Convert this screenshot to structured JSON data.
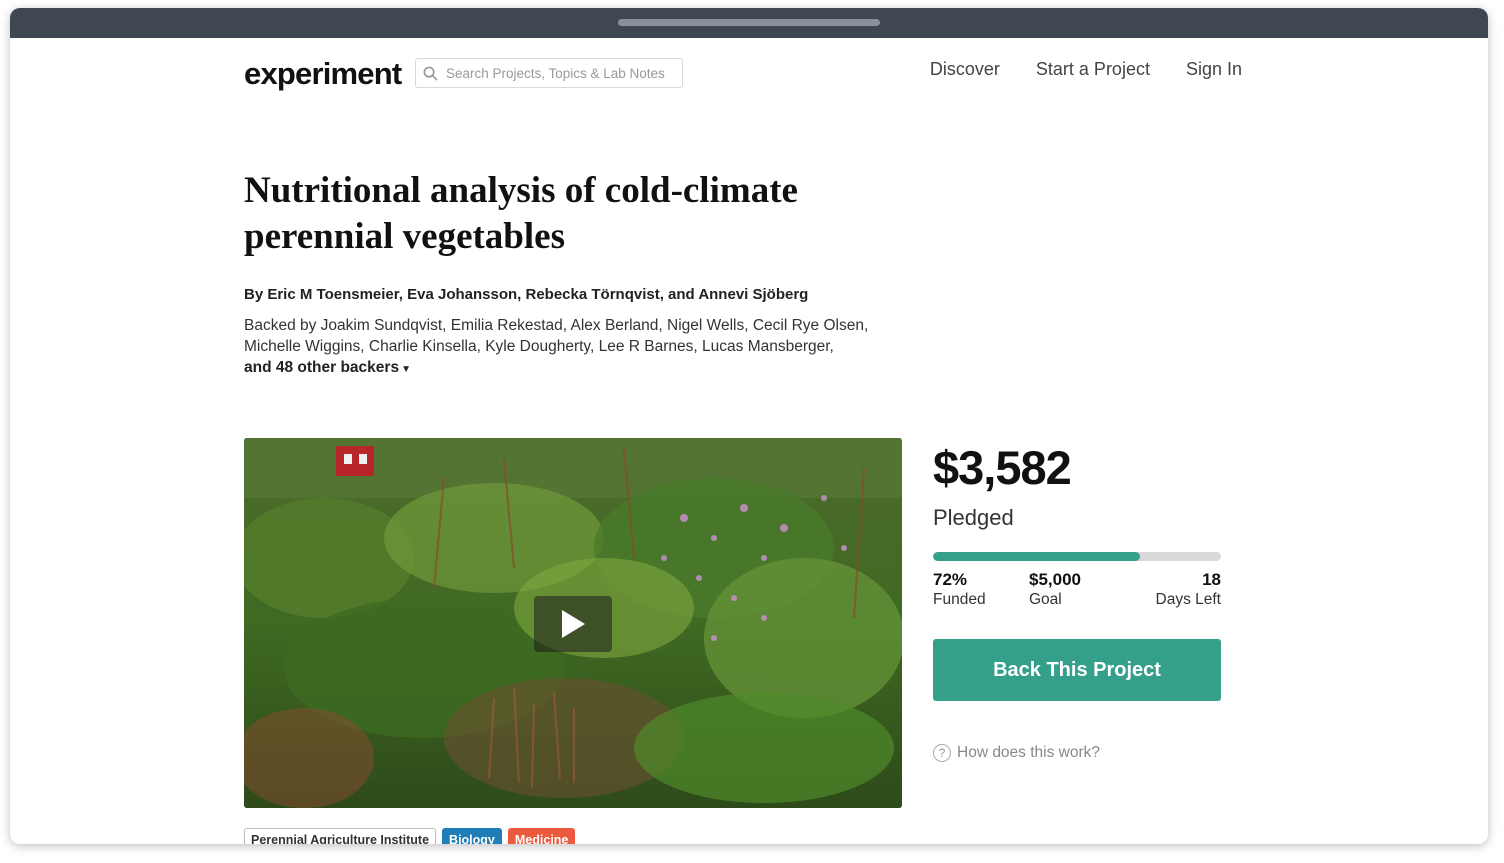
{
  "header": {
    "logo": "experiment",
    "search_placeholder": "Search Projects, Topics & Lab Notes",
    "nav": [
      "Discover",
      "Start a Project",
      "Sign In"
    ]
  },
  "project": {
    "title": "Nutritional analysis of cold-climate perennial vegetables",
    "authors": "By Eric M Toensmeier, Eva Johansson, Rebecka Törnqvist, and Annevi Sjöberg",
    "backers_text": "Backed by Joakim Sundqvist, Emilia Rekestad, Alex Berland, Nigel Wells, Cecil Rye Olsen, Michelle Wiggins, Charlie Kinsella, Kyle Dougherty, Lee R Barnes, Lucas Mansberger,",
    "backers_more": "and 48 other backers",
    "tags": [
      {
        "label": "Perennial Agriculture Institute",
        "kind": "institution"
      },
      {
        "label": "Biology",
        "kind": "category",
        "color": "#1f7db8"
      },
      {
        "label": "Medicine",
        "kind": "category",
        "color": "#ec5a3d"
      }
    ]
  },
  "funding": {
    "amount": "$3,582",
    "pledged_label": "Pledged",
    "progress_fraction": 0.72,
    "funded_value": "72%",
    "funded_label": "Funded",
    "goal_value": "$5,000",
    "goal_label": "Goal",
    "days_value": "18",
    "days_label": "Days Left",
    "cta_label": "Back This Project",
    "help_label": "How does this work?"
  },
  "colors": {
    "accent": "#34a08a",
    "biology": "#1f7db8",
    "medicine": "#ec5a3d",
    "titlebar": "#3f4852"
  }
}
